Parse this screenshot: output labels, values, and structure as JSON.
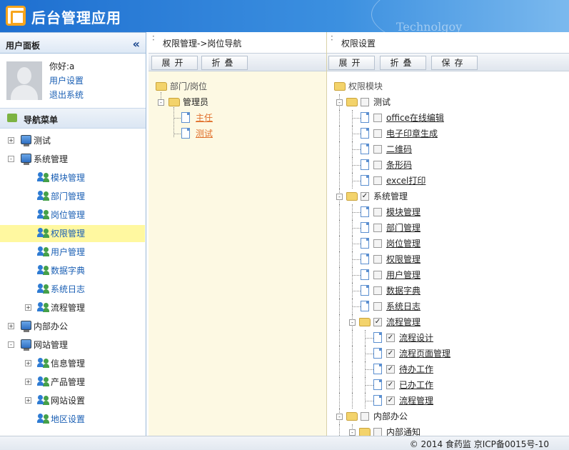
{
  "app": {
    "title": "后台管理应用",
    "watermark": "Technolgoy"
  },
  "left_panel": {
    "title": "用户面板",
    "collapse_glyph": "«",
    "user": {
      "greeting": "你好:a",
      "settings_link": "用户设置",
      "logout_link": "退出系统"
    },
    "nav_title": "导航菜单",
    "nav": [
      {
        "label": "测试",
        "level": 0,
        "toggle": "+",
        "icon": "computer-icon"
      },
      {
        "label": "系统管理",
        "level": 0,
        "toggle": "-",
        "icon": "computer-icon"
      },
      {
        "label": "模块管理",
        "level": 1,
        "icon": "users-icon"
      },
      {
        "label": "部门管理",
        "level": 1,
        "icon": "users-icon"
      },
      {
        "label": "岗位管理",
        "level": 1,
        "icon": "users-icon"
      },
      {
        "label": "权限管理",
        "level": 1,
        "icon": "users-icon",
        "selected": true
      },
      {
        "label": "用户管理",
        "level": 1,
        "icon": "users-icon"
      },
      {
        "label": "数据字典",
        "level": 1,
        "icon": "users-icon"
      },
      {
        "label": "系统日志",
        "level": 1,
        "icon": "users-icon"
      },
      {
        "label": "流程管理",
        "level": 1,
        "toggle": "+",
        "icon": "users-icon"
      },
      {
        "label": "内部办公",
        "level": 0,
        "toggle": "+",
        "icon": "computer-icon"
      },
      {
        "label": "网站管理",
        "level": 0,
        "toggle": "-",
        "icon": "computer-icon"
      },
      {
        "label": "信息管理",
        "level": 1,
        "toggle": "+",
        "icon": "users-icon"
      },
      {
        "label": "产品管理",
        "level": 1,
        "toggle": "+",
        "icon": "users-icon"
      },
      {
        "label": "网站设置",
        "level": 1,
        "toggle": "+",
        "icon": "users-icon"
      },
      {
        "label": "地区设置",
        "level": 1,
        "icon": "users-icon"
      }
    ]
  },
  "mid_panel": {
    "breadcrumb": "权限管理->岗位导航",
    "expand_label": "展开",
    "collapse_label": "折叠",
    "tree": {
      "root": "部门/岗位",
      "group": "管理员",
      "items": [
        "主任",
        "测试"
      ]
    }
  },
  "right_panel": {
    "title": "权限设置",
    "expand_label": "展开",
    "collapse_label": "折叠",
    "save_label": "保存",
    "root": "权限模块",
    "tree": [
      {
        "label": "测试",
        "level": 1,
        "folder": true,
        "checked": false
      },
      {
        "label": "office在线编辑",
        "level": 2,
        "checked": false
      },
      {
        "label": "电子印章生成",
        "level": 2,
        "checked": false
      },
      {
        "label": "二维码",
        "level": 2,
        "checked": false
      },
      {
        "label": "条形码",
        "level": 2,
        "checked": false
      },
      {
        "label": "excel打印",
        "level": 2,
        "checked": false
      },
      {
        "label": "系统管理",
        "level": 1,
        "folder": true,
        "checked": true
      },
      {
        "label": "模块管理",
        "level": 2,
        "checked": false
      },
      {
        "label": "部门管理",
        "level": 2,
        "checked": false
      },
      {
        "label": "岗位管理",
        "level": 2,
        "checked": false
      },
      {
        "label": "权限管理",
        "level": 2,
        "checked": false
      },
      {
        "label": "用户管理",
        "level": 2,
        "checked": false
      },
      {
        "label": "数据字典",
        "level": 2,
        "checked": false
      },
      {
        "label": "系统日志",
        "level": 2,
        "checked": false
      },
      {
        "label": "流程管理",
        "level": 2,
        "folder": true,
        "checked": true
      },
      {
        "label": "流程设计",
        "level": 3,
        "checked": true
      },
      {
        "label": "流程页面管理",
        "level": 3,
        "checked": true
      },
      {
        "label": "待办工作",
        "level": 3,
        "checked": true
      },
      {
        "label": "已办工作",
        "level": 3,
        "checked": true
      },
      {
        "label": "流程管理",
        "level": 3,
        "checked": true
      },
      {
        "label": "内部办公",
        "level": 1,
        "folder": true,
        "checked": false
      },
      {
        "label": "内部通知",
        "level": 2,
        "folder": true,
        "checked": false
      }
    ]
  },
  "footer": {
    "text": "© 2014 食药监 京ICP备0015号-10"
  },
  "colors": {
    "header": "#2a7fd8",
    "selected_nav": "#fff8a0",
    "mid_bg": "#fdf9e3",
    "link": "#1a5fb4",
    "orange_link": "#e0702c"
  }
}
